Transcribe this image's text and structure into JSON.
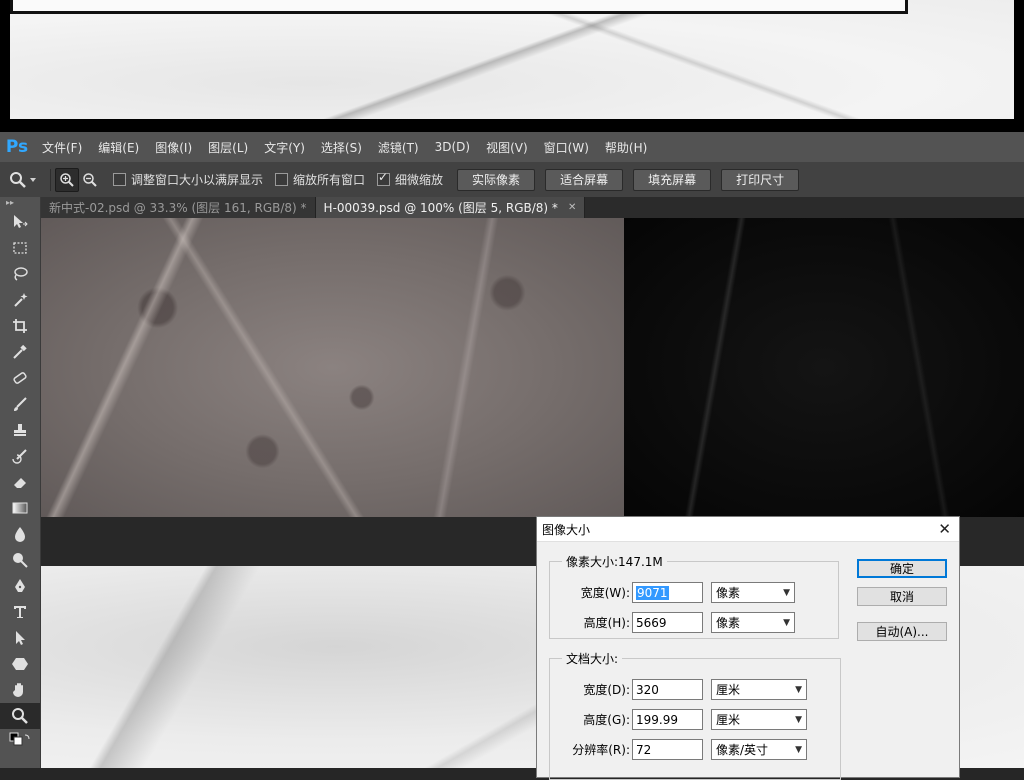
{
  "app": {
    "logo": "Ps"
  },
  "menu": [
    "文件(F)",
    "编辑(E)",
    "图像(I)",
    "图层(L)",
    "文字(Y)",
    "选择(S)",
    "滤镜(T)",
    "3D(D)",
    "视图(V)",
    "窗口(W)",
    "帮助(H)"
  ],
  "options": {
    "check_fit_window": "调整窗口大小以满屏显示",
    "check_zoom_all": "缩放所有窗口",
    "check_scrubby": "细微缩放",
    "btn_actual": "实际像素",
    "btn_fit": "适合屏幕",
    "btn_fill": "填充屏幕",
    "btn_print": "打印尺寸"
  },
  "tabs": [
    {
      "label": "新中式-02.psd @ 33.3% (图层 161, RGB/8) *",
      "active": false
    },
    {
      "label": "H-00039.psd @ 100% (图层 5, RGB/8) *",
      "active": true
    }
  ],
  "dialog": {
    "title": "图像大小",
    "pixel_group": "像素大小:147.1M",
    "width_label": "宽度(W):",
    "width_value": "9071",
    "width_unit": "像素",
    "height_label": "高度(H):",
    "height_value": "5669",
    "height_unit": "像素",
    "doc_group": "文档大小:",
    "doc_width_label": "宽度(D):",
    "doc_width_value": "320",
    "doc_width_unit": "厘米",
    "doc_height_label": "高度(G):",
    "doc_height_value": "199.99",
    "doc_height_unit": "厘米",
    "res_label": "分辨率(R):",
    "res_value": "72",
    "res_unit": "像素/英寸",
    "ok": "确定",
    "cancel": "取消",
    "auto": "自动(A)..."
  }
}
